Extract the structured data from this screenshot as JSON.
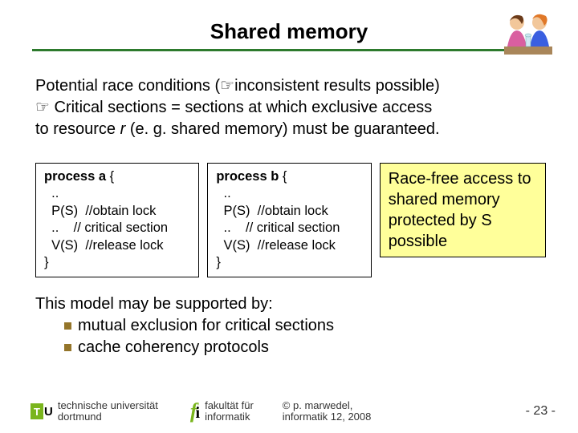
{
  "title": "Shared memory",
  "intro_line1_a": "Potential race conditions (",
  "intro_line1_b": "inconsistent results possible)",
  "intro_line2": " Critical sections = sections at which exclusive access",
  "intro_line3_a": "to resource ",
  "intro_line3_r": "r",
  "intro_line3_b": " (e. g. shared memory) must be guaranteed.",
  "proc_a": {
    "header": "process a {",
    "l1": "  ..",
    "l2": "  P(S)  //obtain lock",
    "l3": "  ..    // critical section",
    "l4": "  V(S)  //release lock",
    "close": "}"
  },
  "proc_b": {
    "header": "process b {",
    "l1": "  ..",
    "l2": "  P(S)  //obtain lock",
    "l3": "  ..    // critical section",
    "l4": "  V(S)  //release lock",
    "close": "}"
  },
  "note": "Race-free access to shared memory protected by S possible",
  "after_lead": "This model may be supported by:",
  "after_b1": "mutual exclusion for critical sections",
  "after_b2": "cache coherency protocols",
  "footer": {
    "uni1": "technische universität",
    "uni2": "dortmund",
    "fak1": "fakultät für",
    "fak2": "informatik",
    "copy1": "©  p. marwedel,",
    "copy2": "informatik 12,  2008",
    "page": "-  23 -"
  },
  "pointer_glyph": "☞"
}
